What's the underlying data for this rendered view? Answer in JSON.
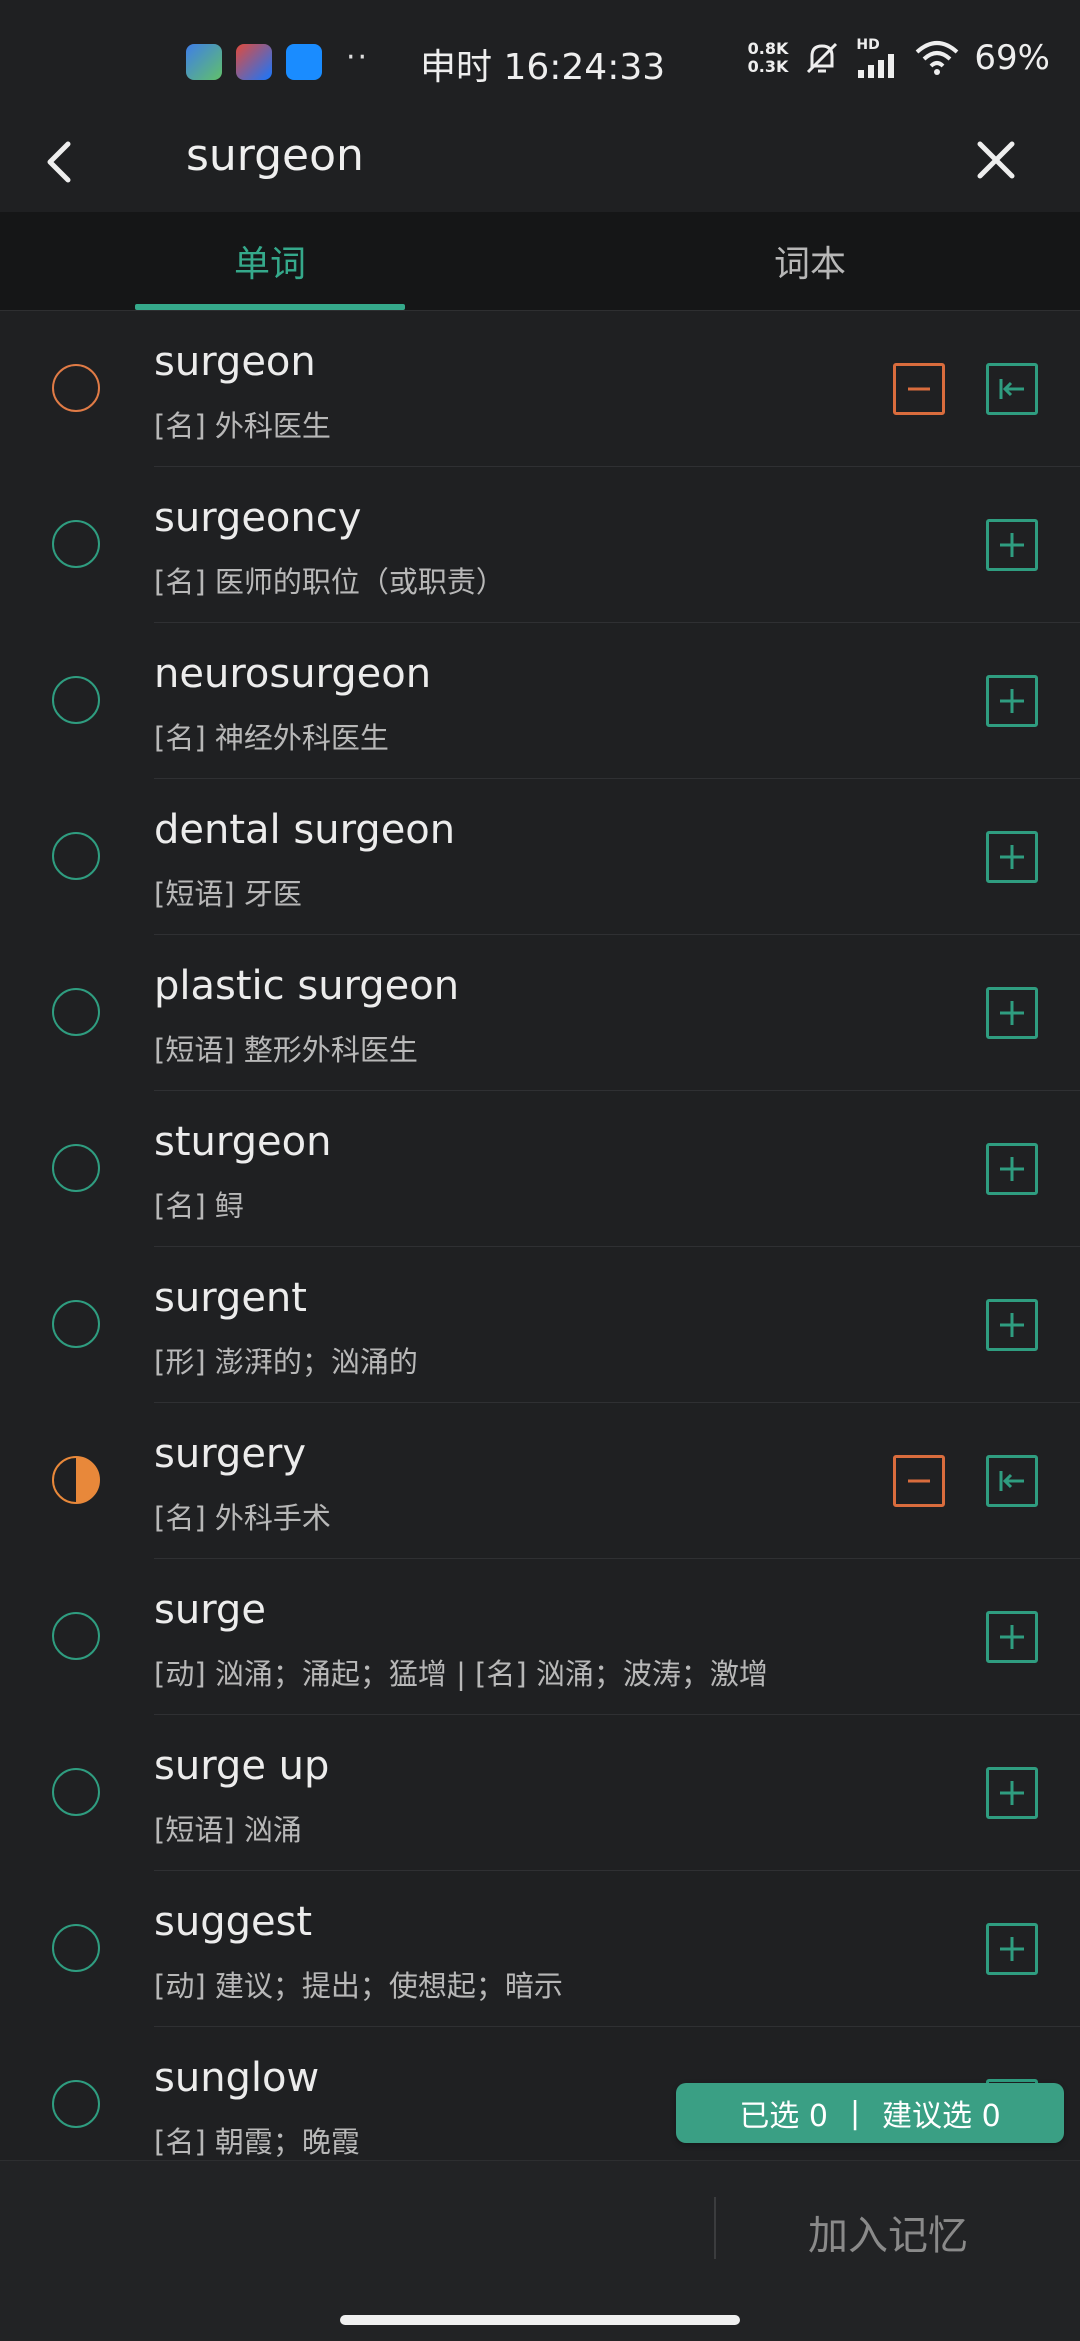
{
  "status_bar": {
    "time_label": "申时 16:24:33",
    "dots": "··",
    "net_up": "0.8K",
    "net_down": "0.3K",
    "hd": "HD",
    "battery": "69%"
  },
  "search": {
    "query": "surgeon"
  },
  "tabs": [
    {
      "label": "单词",
      "active": true
    },
    {
      "label": "词本",
      "active": false
    }
  ],
  "entries": [
    {
      "word": "surgeon",
      "def": "[名] 外科医生",
      "state": "orange",
      "actions": [
        "minus",
        "jump"
      ]
    },
    {
      "word": "surgeoncy",
      "def": "[名] 医师的职位（或职责）",
      "state": "empty",
      "actions": [
        "add"
      ]
    },
    {
      "word": "neurosurgeon",
      "def": "[名] 神经外科医生",
      "state": "empty",
      "actions": [
        "add"
      ]
    },
    {
      "word": "dental surgeon",
      "def": "[短语] 牙医",
      "state": "empty",
      "actions": [
        "add"
      ]
    },
    {
      "word": "plastic surgeon",
      "def": "[短语] 整形外科医生",
      "state": "empty",
      "actions": [
        "add"
      ]
    },
    {
      "word": "sturgeon",
      "def": "[名] 鲟",
      "state": "empty",
      "actions": [
        "add"
      ]
    },
    {
      "word": "surgent",
      "def": "[形] 澎湃的；汹涌的",
      "state": "empty",
      "actions": [
        "add"
      ]
    },
    {
      "word": "surgery",
      "def": "[名] 外科手术",
      "state": "half",
      "actions": [
        "minus",
        "jump"
      ]
    },
    {
      "word": "surge",
      "def": "[动] 汹涌；涌起；猛增 | [名] 汹涌；波涛；激增",
      "state": "empty",
      "actions": [
        "add"
      ]
    },
    {
      "word": "surge up",
      "def": "[短语] 汹涌",
      "state": "empty",
      "actions": [
        "add"
      ]
    },
    {
      "word": "suggest",
      "def": "[动] 建议；提出；使想起；暗示",
      "state": "empty",
      "actions": [
        "add"
      ]
    },
    {
      "word": "sunglow",
      "def": "[名] 朝霞；晚霞",
      "state": "empty",
      "actions": [
        "add"
      ]
    }
  ],
  "selection": {
    "selected_label": "已选 0",
    "separator": "|",
    "suggested_label": "建议选 0"
  },
  "footer": {
    "add_memory_label": "加入记忆"
  },
  "colors": {
    "accent": "#35a98b",
    "warn": "#d96c3d",
    "bg": "#1f2022"
  }
}
